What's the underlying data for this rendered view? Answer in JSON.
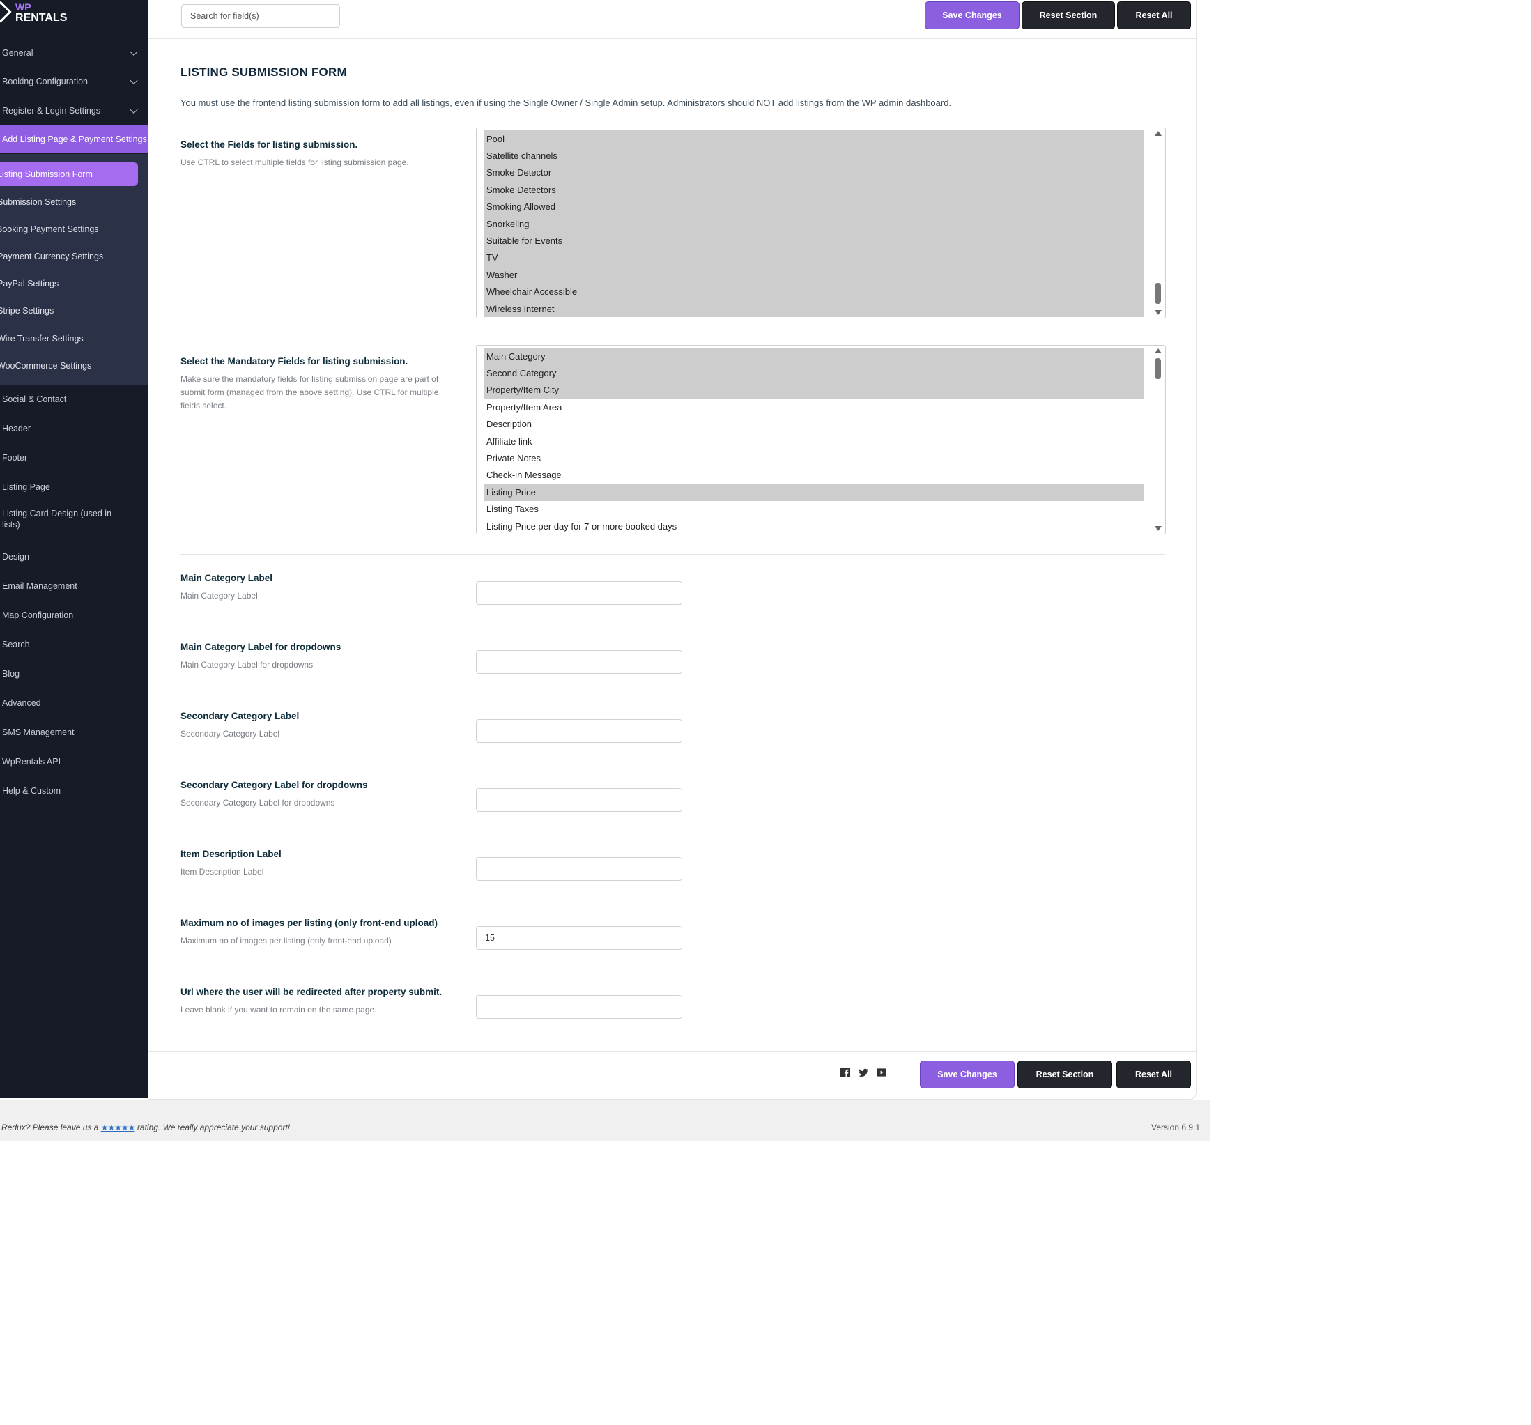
{
  "logo": {
    "line1": "WP",
    "line2": "RENTALS"
  },
  "nav": {
    "items": [
      {
        "label": "General",
        "chevron": true
      },
      {
        "label": "Booking Configuration",
        "chevron": true
      },
      {
        "label": "Register & Login Settings",
        "chevron": true
      },
      {
        "label": "Add Listing Page & Payment Settings",
        "chevron": false,
        "active": true
      }
    ],
    "sub_items": [
      {
        "label": "Listing Submission Form",
        "active": true
      },
      {
        "label": "Submission Settings"
      },
      {
        "label": "Booking Payment Settings"
      },
      {
        "label": "Payment Currency Settings"
      },
      {
        "label": "PayPal Settings"
      },
      {
        "label": "Stripe Settings"
      },
      {
        "label": "Wire Transfer Settings"
      },
      {
        "label": "WooCommerce Settings"
      }
    ],
    "items_after": [
      {
        "label": "Social & Contact",
        "chevron": true
      },
      {
        "label": "Header",
        "chevron": true
      },
      {
        "label": "Footer",
        "chevron": true
      },
      {
        "label": "Listing Page",
        "chevron": true
      },
      {
        "label": "Listing Card Design (used in lists)",
        "chevron": true,
        "two_line": true
      },
      {
        "label": "Design",
        "chevron": true
      },
      {
        "label": "Email Management",
        "chevron": true
      },
      {
        "label": "Map Configuration",
        "chevron": true
      },
      {
        "label": "Search",
        "chevron": true
      },
      {
        "label": "Blog",
        "chevron": true
      },
      {
        "label": "Advanced",
        "chevron": true
      },
      {
        "label": "SMS Management",
        "chevron": false
      },
      {
        "label": "WpRentals API",
        "chevron": false
      },
      {
        "label": "Help & Custom",
        "chevron": true
      }
    ]
  },
  "toolbar": {
    "search_placeholder": "Search for field(s)",
    "save_label": "Save Changes",
    "reset_section_label": "Reset Section",
    "reset_all_label": "Reset All"
  },
  "section": {
    "title": "LISTING SUBMISSION FORM",
    "description": "You must use the frontend listing submission form to add all listings, even if using the Single Owner / Single Admin setup. Administrators should NOT add listings from the WP admin dashboard."
  },
  "fields_select": {
    "label": "Select the Fields for listing submission.",
    "description": "Use CTRL to select multiple fields for listing submission page.",
    "options": [
      {
        "label": "Pool",
        "selected": true
      },
      {
        "label": "Satellite channels",
        "selected": true
      },
      {
        "label": "Smoke Detector",
        "selected": true
      },
      {
        "label": "Smoke Detectors",
        "selected": true
      },
      {
        "label": "Smoking Allowed",
        "selected": true
      },
      {
        "label": "Snorkeling",
        "selected": true
      },
      {
        "label": "Suitable for Events",
        "selected": true
      },
      {
        "label": "TV",
        "selected": true
      },
      {
        "label": "Washer",
        "selected": true
      },
      {
        "label": "Wheelchair Accessible",
        "selected": true
      },
      {
        "label": "Wireless Internet",
        "selected": true
      }
    ]
  },
  "mandatory_select": {
    "label": "Select the Mandatory Fields for listing submission.",
    "description": "Make sure the mandatory fields for listing submission page are part of submit form (managed from the above setting). Use CTRL for multiple fields select.",
    "options": [
      {
        "label": "Main Category",
        "selected": true
      },
      {
        "label": "Second Category",
        "selected": true
      },
      {
        "label": "Property/Item City",
        "selected": true
      },
      {
        "label": "Property/Item Area",
        "selected": false
      },
      {
        "label": "Description",
        "selected": false
      },
      {
        "label": "Affiliate link",
        "selected": false
      },
      {
        "label": "Private Notes",
        "selected": false
      },
      {
        "label": "Check-in Message",
        "selected": false
      },
      {
        "label": "Listing Price",
        "selected": true
      },
      {
        "label": "Listing Taxes",
        "selected": false
      },
      {
        "label": "Listing Price per day for 7 or more booked days",
        "selected": false
      }
    ]
  },
  "text_fields": [
    {
      "label": "Main Category Label",
      "description": "Main Category Label",
      "value": ""
    },
    {
      "label": "Main Category Label for dropdowns",
      "description": "Main Category Label for dropdowns",
      "value": ""
    },
    {
      "label": "Secondary Category Label",
      "description": "Secondary Category Label",
      "value": ""
    },
    {
      "label": "Secondary Category Label for dropdowns",
      "description": "Secondary Category Label for dropdowns",
      "value": ""
    },
    {
      "label": "Item Description Label",
      "description": "Item Description Label",
      "value": ""
    },
    {
      "label": "Maximum no of images per listing (only front-end upload)",
      "description": "Maximum no of images per listing (only front-end upload)",
      "value": "15"
    },
    {
      "label": "Url where the user will be redirected after property submit.",
      "description": "Leave blank if you want to remain on the same page.",
      "value": ""
    }
  ],
  "footer": {
    "note_prefix": "Redux",
    "note_mid": "? Please leave us a ",
    "note_stars": "★★★★★",
    "note_suffix": " rating. We really appreciate your support!",
    "version": "Version 6.9.1"
  },
  "colors": {
    "sidebar_bg": "#161b27",
    "subnav_bg": "#2b3147",
    "accent": "#8c5ee0",
    "dark_button": "#23262d",
    "selected_option": "#cdcdcd"
  }
}
